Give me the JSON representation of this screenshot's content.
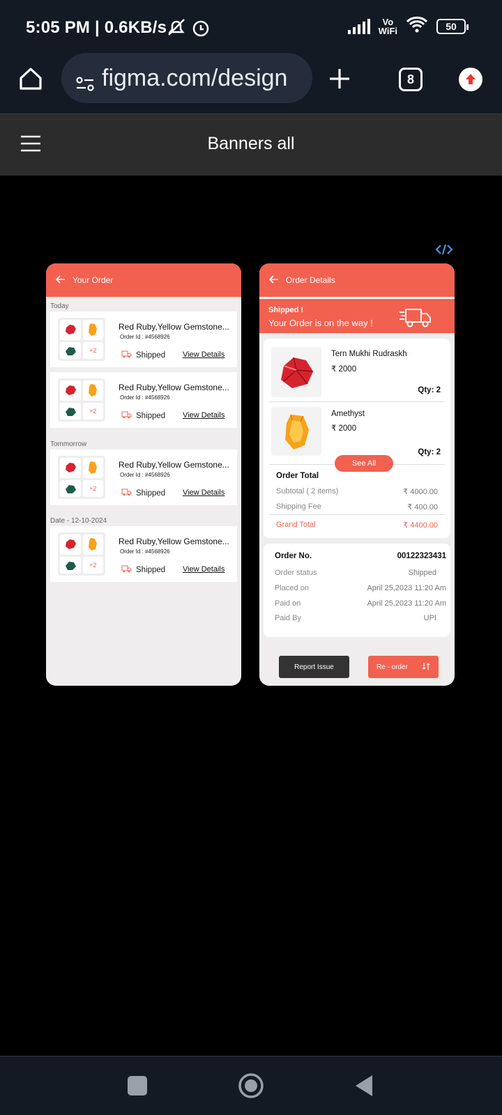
{
  "status_bar": {
    "time": "5:05 PM | 0.6KB/s",
    "vo": "Vo",
    "wifi": "WiFi",
    "battery": "50"
  },
  "browser": {
    "url": "figma.com/design",
    "tab_count": "8"
  },
  "figma": {
    "title": "Banners all"
  },
  "colors": {
    "accent": "#f26150",
    "dark_btn": "#333333"
  },
  "order_list": {
    "header": "Your Order",
    "sections": [
      {
        "label": "Today",
        "items": [
          {
            "name": "Red Ruby,Yellow Gemstone...",
            "order_id": "Order Id : #4568926",
            "more": "+2",
            "status": "Shipped",
            "link": "View Details"
          },
          {
            "name": "Red Ruby,Yellow Gemstone...",
            "order_id": "Order Id : #4568926",
            "more": "+2",
            "status": "Shipped",
            "link": "View Details"
          }
        ]
      },
      {
        "label": "Tommorrow",
        "items": [
          {
            "name": "Red Ruby,Yellow Gemstone...",
            "order_id": "Order Id : #4568926",
            "more": "+2",
            "status": "Shipped",
            "link": "View Details"
          }
        ]
      },
      {
        "label": "Date - 12-10-2024",
        "items": [
          {
            "name": "Red Ruby,Yellow Gemstone...",
            "order_id": "Order Id : #4568926",
            "more": "+2",
            "status": "Shipped",
            "link": "View Details"
          }
        ]
      }
    ]
  },
  "order_details": {
    "header": "Order Details",
    "banner_title": "Shipped !",
    "banner_sub": "Your Order is on the way !",
    "products": [
      {
        "name": "Tern Mukhi Rudraskh",
        "price": "₹ 2000",
        "qty": "Qty: 2"
      },
      {
        "name": "Amethyst",
        "price": "₹ 2000",
        "qty": "Qty: 2"
      }
    ],
    "see_all": "See All",
    "total_title": "Order Total",
    "subtotal_label": "Subtotal ( 2 items)",
    "subtotal": "₹ 4000.00",
    "shipping_label": "Shipping Fee",
    "shipping": "₹ 400.00",
    "grand_label": "Grand Total",
    "grand": "₹ 4400.00",
    "order_no_label": "Order No.",
    "order_no": "00122323431",
    "status_label": "Order status",
    "status": "Shipped",
    "placed_label": "Placed on",
    "placed": "April 25,2023 11:20 Am",
    "paid_label": "Paid on",
    "paid": "April 25,2023 11:20 Am",
    "paidby_label": "Paid By",
    "paidby": "UPI",
    "report_btn": "Report Issue",
    "reorder_btn": "Re - order"
  },
  "icons": {
    "code": "code-icon"
  }
}
